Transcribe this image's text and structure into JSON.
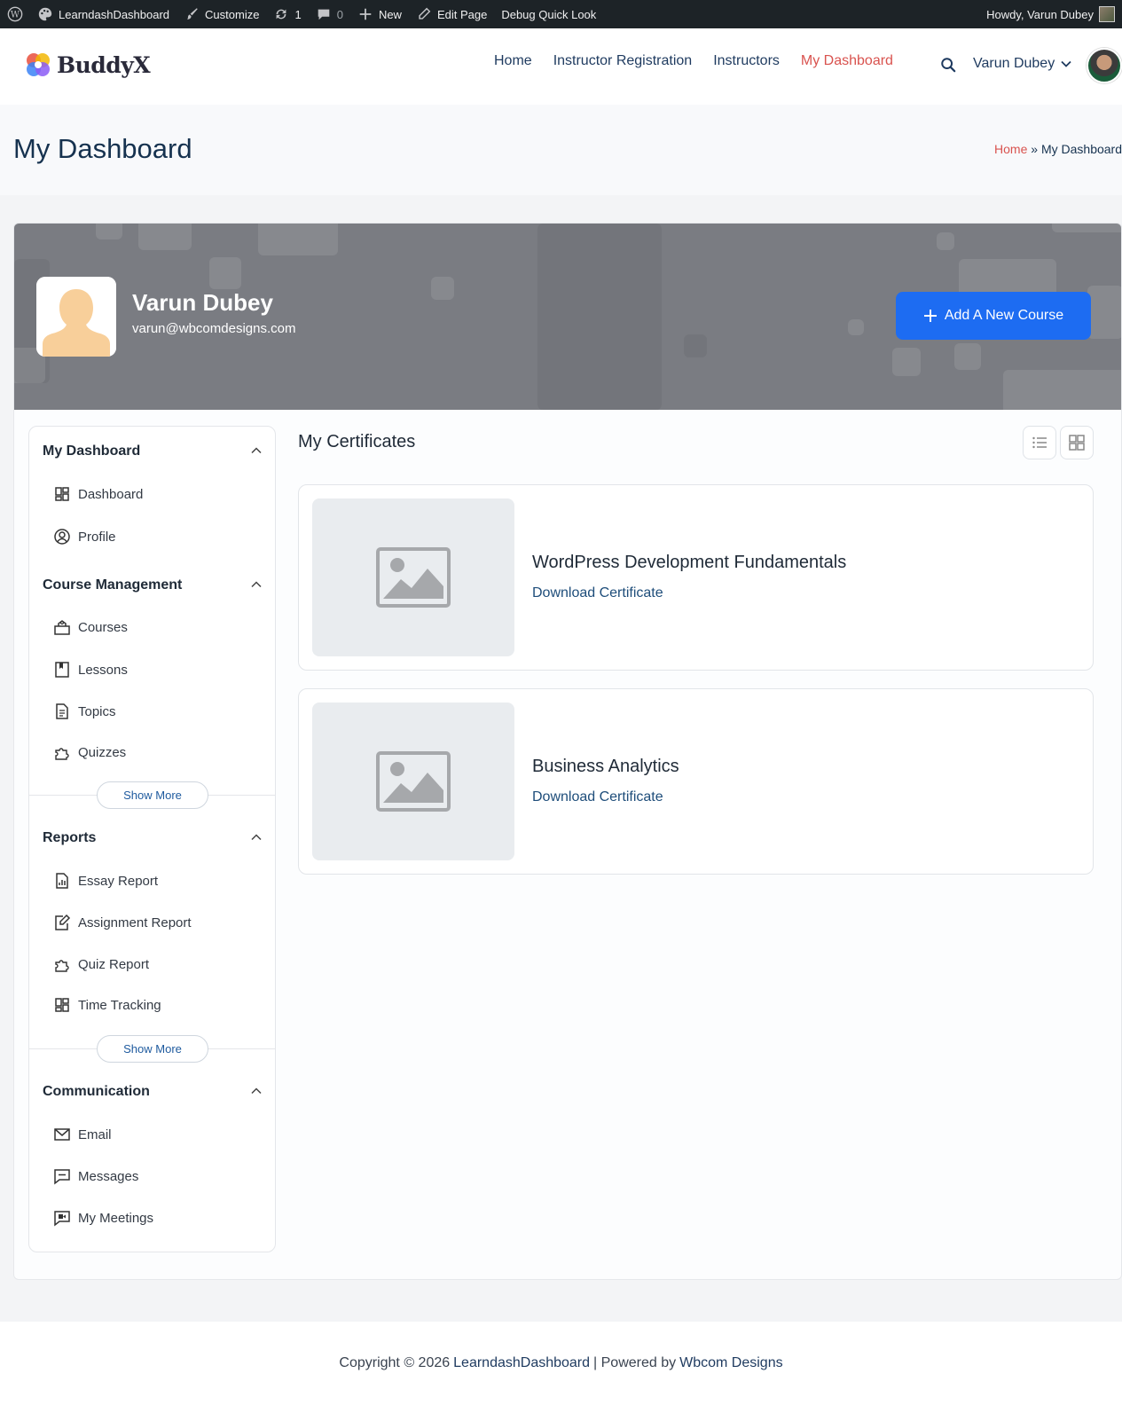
{
  "admin_bar": {
    "site_name": "LearndashDashboard",
    "customize": "Customize",
    "updates_count": "1",
    "comments_count": "0",
    "new_label": "New",
    "edit_page": "Edit Page",
    "debug": "Debug Quick Look",
    "howdy": "Howdy, Varun Dubey"
  },
  "header": {
    "logo_text": "BuddyX",
    "nav": [
      "Home",
      "Instructor Registration",
      "Instructors",
      "My Dashboard"
    ],
    "active_nav": "My Dashboard",
    "user_name": "Varun Dubey"
  },
  "title_band": {
    "title": "My Dashboard",
    "breadcrumb_home": "Home",
    "breadcrumb_sep": "»",
    "breadcrumb_current": "My Dashboard"
  },
  "profile": {
    "name": "Varun Dubey",
    "email": "varun@wbcomdesigns.com",
    "add_course_label": "Add A New Course"
  },
  "sidebar": {
    "sections": [
      {
        "title": "My Dashboard",
        "items": [
          "Dashboard",
          "Profile"
        ]
      },
      {
        "title": "Course Management",
        "items": [
          "Courses",
          "Lessons",
          "Topics",
          "Quizzes"
        ],
        "show_more": "Show More"
      },
      {
        "title": "Reports",
        "items": [
          "Essay Report",
          "Assignment Report",
          "Quiz Report",
          "Time Tracking"
        ],
        "show_more": "Show More"
      },
      {
        "title": "Communication",
        "items": [
          "Email",
          "Messages",
          "My Meetings"
        ]
      }
    ]
  },
  "content": {
    "title": "My Certificates",
    "certificates": [
      {
        "title": "WordPress Development Fundamentals",
        "link": "Download Certificate"
      },
      {
        "title": "Business Analytics",
        "link": "Download Certificate"
      }
    ]
  },
  "footer": {
    "copyright": "Copyright © 2026",
    "site_link": "LearndashDashboard",
    "powered": "| Powered by",
    "company_link": "Wbcom Designs"
  },
  "colors": {
    "accent_blue": "#1d6cf2",
    "active_red": "#d9534f",
    "banner_gray": "#7a7c82"
  }
}
